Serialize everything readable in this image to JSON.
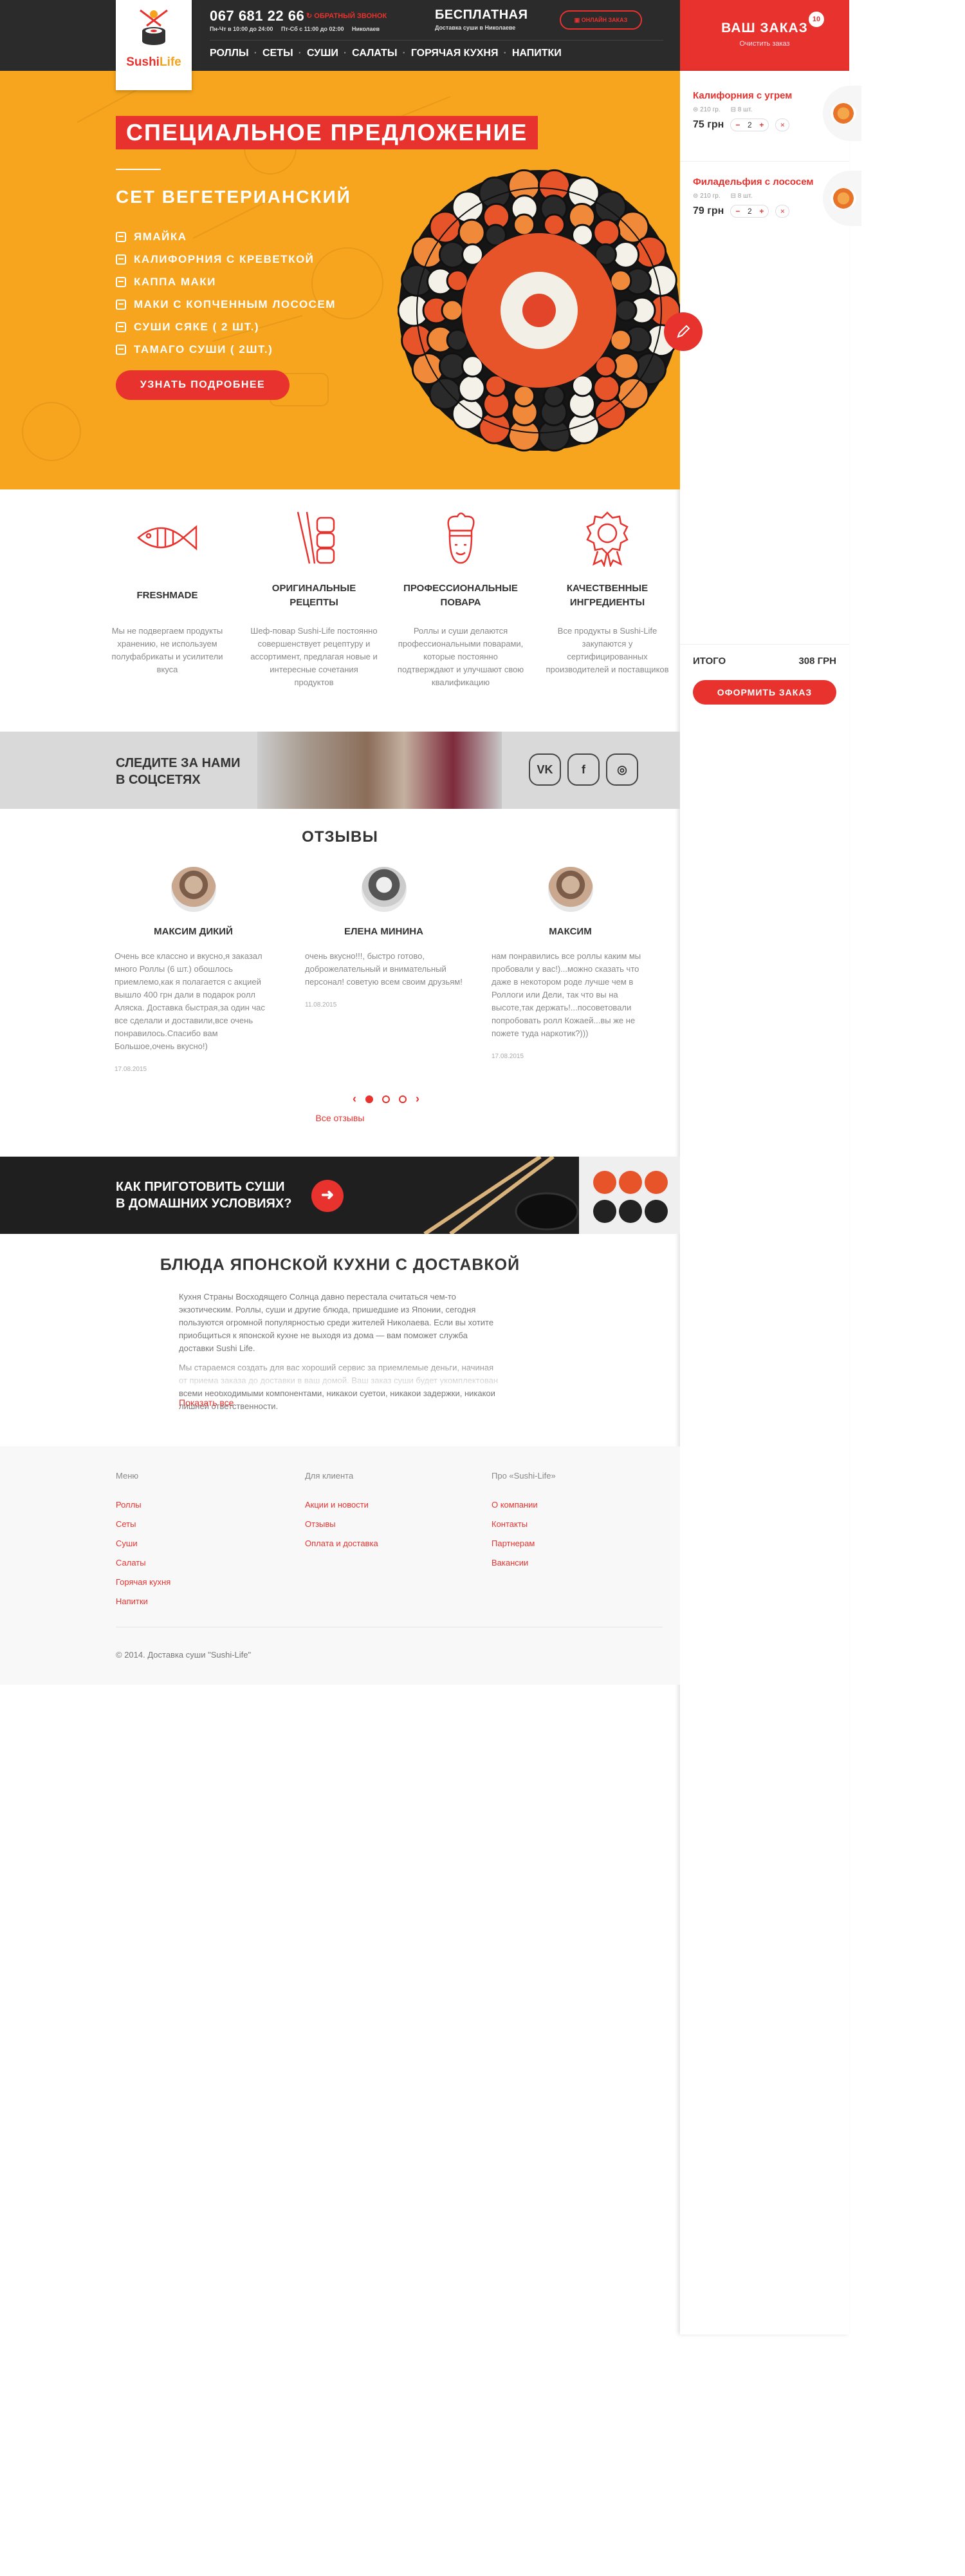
{
  "brand": {
    "logo_part1": "Sushi",
    "logo_part2": "Life"
  },
  "header": {
    "phone": "067 681 22 66",
    "callback": "ОБРАТНЫЙ ЗВОНОК",
    "hours_weekday": "Пн-Чт в 10:00 до 24:00",
    "hours_weekend": "Пт-Сб с 11:00 до 02:00",
    "city": "Николаев",
    "free_title": "БЕСПЛАТНАЯ",
    "free_sub": "Доставка суши в Николаеве",
    "online_btn": "ОНЛАЙН ЗАКАЗ",
    "nav": [
      "РОЛЛЫ",
      "СЕТЫ",
      "СУШИ",
      "САЛАТЫ",
      "ГОРЯЧАЯ КУХНЯ",
      "НАПИТКИ"
    ]
  },
  "order": {
    "title": "ВАШ ЗАКАЗ",
    "clear": "Очистить заказ",
    "badge": "10",
    "items": [
      {
        "name": "Калифорния с угрем",
        "weight": "210 гр.",
        "pieces": "8 шт.",
        "price": "75 грн",
        "qty": "2"
      },
      {
        "name": "Филадельфия с лососем",
        "weight": "210 гр.",
        "pieces": "8 шт.",
        "price": "79 грн",
        "qty": "2"
      }
    ],
    "total_label": "ИТОГО",
    "total_value": "308 грн",
    "checkout": "ОФОРМИТЬ ЗАКАЗ"
  },
  "hero": {
    "special": "СПЕЦИАЛЬНОЕ ПРЕДЛОЖЕНИЕ",
    "set_title": "СЕТ ВЕГЕТЕРИАНСКИЙ",
    "items": [
      "ЯМАЙКА",
      "КАЛИФОРНИЯ С КРЕВЕТКОЙ",
      "КАППА МАКИ",
      "МАКИ С КОПЧЕННЫМ ЛОСОСЕМ",
      "СУШИ СЯКЕ ( 2 ШТ.)",
      "ТАМАГО СУШИ ( 2ШТ.)"
    ],
    "more_btn": "УЗНАТЬ ПОДРОБНЕЕ"
  },
  "features": [
    {
      "title": "FRESHMADE",
      "text": "Мы не подвергаем продукты хранению, не используем полуфабрикаты и усилители вкуса",
      "icon": "fish-icon"
    },
    {
      "title": "ОРИГИНАЛЬНЫЕ РЕЦЕПТЫ",
      "text": "Шеф-повар Sushi-Life постоянно совершенствует рецептуру и ассортимент, предлагая новые и интересные сочетания продуктов",
      "icon": "chopsticks-sushi-icon"
    },
    {
      "title": "ПРОФЕССИОНАЛЬНЫЕ ПОВАРА",
      "text": "Роллы и суши делаются профессиональными поварами, которые постоянно подтверждают и улучшают свою квалификацию",
      "icon": "chef-icon"
    },
    {
      "title": "КАЧЕСТВЕННЫЕ ИНГРЕДИЕНТЫ",
      "text": "Все продукты в Sushi-Life закупаются у сертифицированных производителей и поставщиков",
      "icon": "quality-badge-icon"
    }
  ],
  "social": {
    "title": "СЛЕДИТЕ ЗА НАМИ\nВ СОЦСЕТЯХ",
    "vk": "VK",
    "fb": "f",
    "ig": "◎"
  },
  "reviews": {
    "title": "ОТЗЫВЫ",
    "items": [
      {
        "name": "МАКСИМ ДИКИЙ",
        "text": "Очень все классно и вкусно,я заказал много Роллы (6 шт.) обошлось приемлемо,как я полагается с акцией вышло 400 грн дали в подарок ролл Аляска. Доставка быстрая,за один час все сделали и доставили,все очень понравилось.Спасибо вам Большое,очень вкусно!)",
        "date": "17.08.2015"
      },
      {
        "name": "ЕЛЕНА МИНИНА",
        "text": "очень вкусно!!!, быстро готово, доброжелательный и внимательный персонал! советую всем своим друзьям!",
        "date": "11.08.2015"
      },
      {
        "name": "МАКСИМ",
        "text": "нам понравились все роллы каким мы пробовали у вас!)...можно сказать что даже в некотором роде лучше чем в Роллоги или Дели, так что вы на высоте,так держать!...посоветовали попробовать ролл Кожаей...вы же не пожете туда наркотик?)))",
        "date": "17.08.2015"
      }
    ],
    "all": "Все отзывы"
  },
  "howto": {
    "title": "КАК ПРИГОТОВИТЬ СУШИ\nВ ДОМАШНИХ УСЛОВИЯХ?"
  },
  "about": {
    "title": "БЛЮДА ЯПОНСКОЙ КУХНИ С ДОСТАВКОЙ",
    "p1": "Кухня Страны Восходящего Солнца давно перестала считаться чем-то экзотическим. Роллы, суши и другие блюда, пришедшие из Японии, сегодня пользуются огромной популярностью среди жителей Николаева. Если вы хотите приобщиться к японской кухне не выходя из дома — вам поможет служба доставки Sushi Life.",
    "p2": "Мы стараемся создать для вас хороший сервис за приемлемые деньги, начиная от приема заказа до доставки в ваш домой. Ваш заказ суши будет укомплектован всеми необходимыми компонентами, никакой суетой, никакой задержки, никакой лишней ответственности.",
    "show_all": "Показать все"
  },
  "footer": {
    "cols": [
      {
        "title": "Меню",
        "links": [
          "Роллы",
          "Сеты",
          "Суши",
          "Салаты",
          "Горячая кухня",
          "Напитки"
        ]
      },
      {
        "title": "Для клиента",
        "links": [
          "Акции и новости",
          "Отзывы",
          "Оплата и доставка"
        ]
      },
      {
        "title": "Про «Sushi-Life»",
        "links": [
          "О компании",
          "Контакты",
          "Партнерам",
          "Вакансии"
        ]
      }
    ],
    "copyright": "© 2014. Доставка суши \"Sushi-Life\""
  },
  "colors": {
    "accent": "#e8322e",
    "hero_bg": "#f7a51e",
    "header_bg": "#2b2b2b"
  }
}
